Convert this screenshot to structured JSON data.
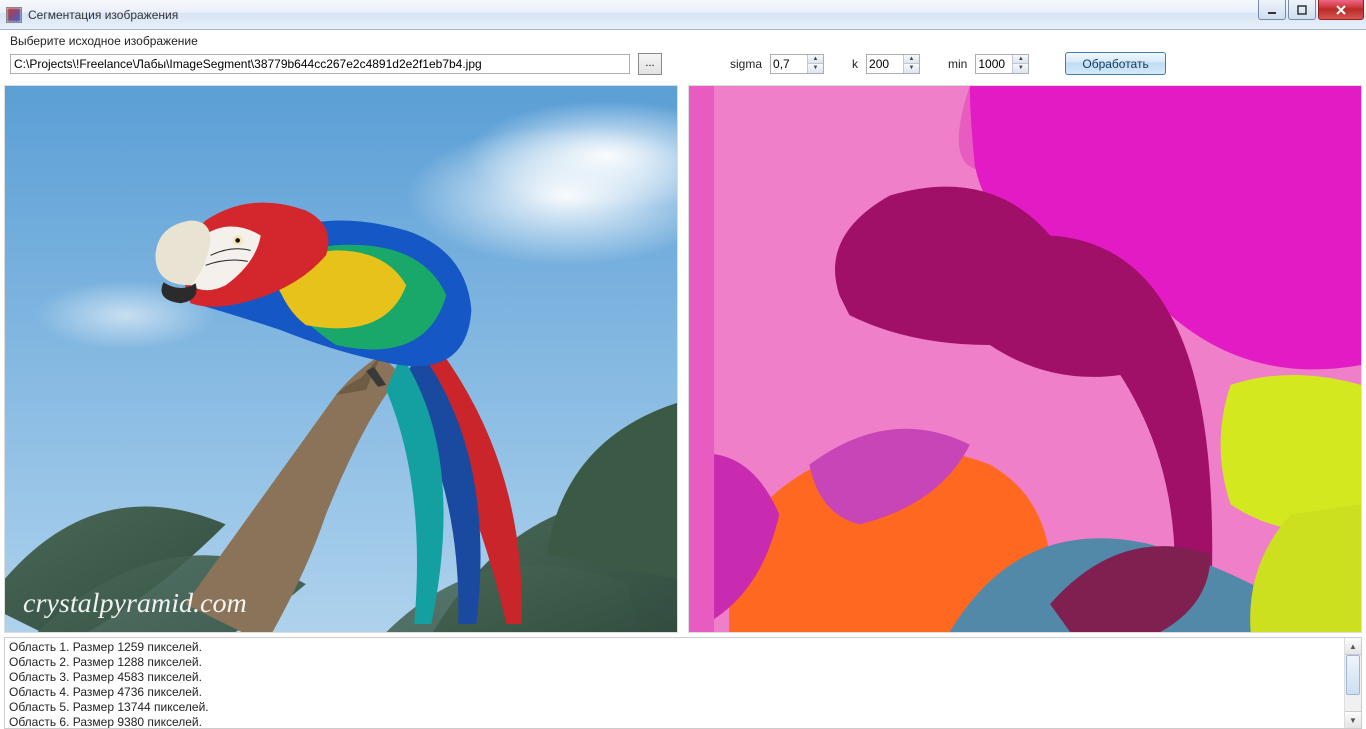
{
  "window": {
    "title": "Сегментация изображения"
  },
  "file": {
    "label": "Выберите исходное изображение",
    "path": "C:\\Projects\\!Freelance\\Лабы\\ImageSegment\\38779b644cc267e2c4891d2e2f1eb7b4.jpg",
    "browse": "..."
  },
  "params": {
    "sigma_label": "sigma",
    "sigma_value": "0,7",
    "k_label": "k",
    "k_value": "200",
    "min_label": "min",
    "min_value": "1000"
  },
  "action": {
    "process": "Обработать"
  },
  "source_watermark": "crystalpyramid.com",
  "log": [
    "Область 1. Размер 1259 пикселей.",
    "Область 2. Размер 1288 пикселей.",
    "Область 3. Размер 4583 пикселей.",
    "Область 4. Размер 4736 пикселей.",
    "Область 5. Размер 13744 пикселей.",
    "Область 6. Размер 9380 пикселей."
  ],
  "segmentation_colors": {
    "sky_top": "#e85bc0",
    "sky_mid": "#ee7fc8",
    "bird_body": "#a01068",
    "foliage_cyan": "#5288a8",
    "foliage_orange": "#ff6820",
    "foliage_magenta": "#c845b8",
    "foliage_green": "#d4e820",
    "branch_dark": "#802050"
  }
}
